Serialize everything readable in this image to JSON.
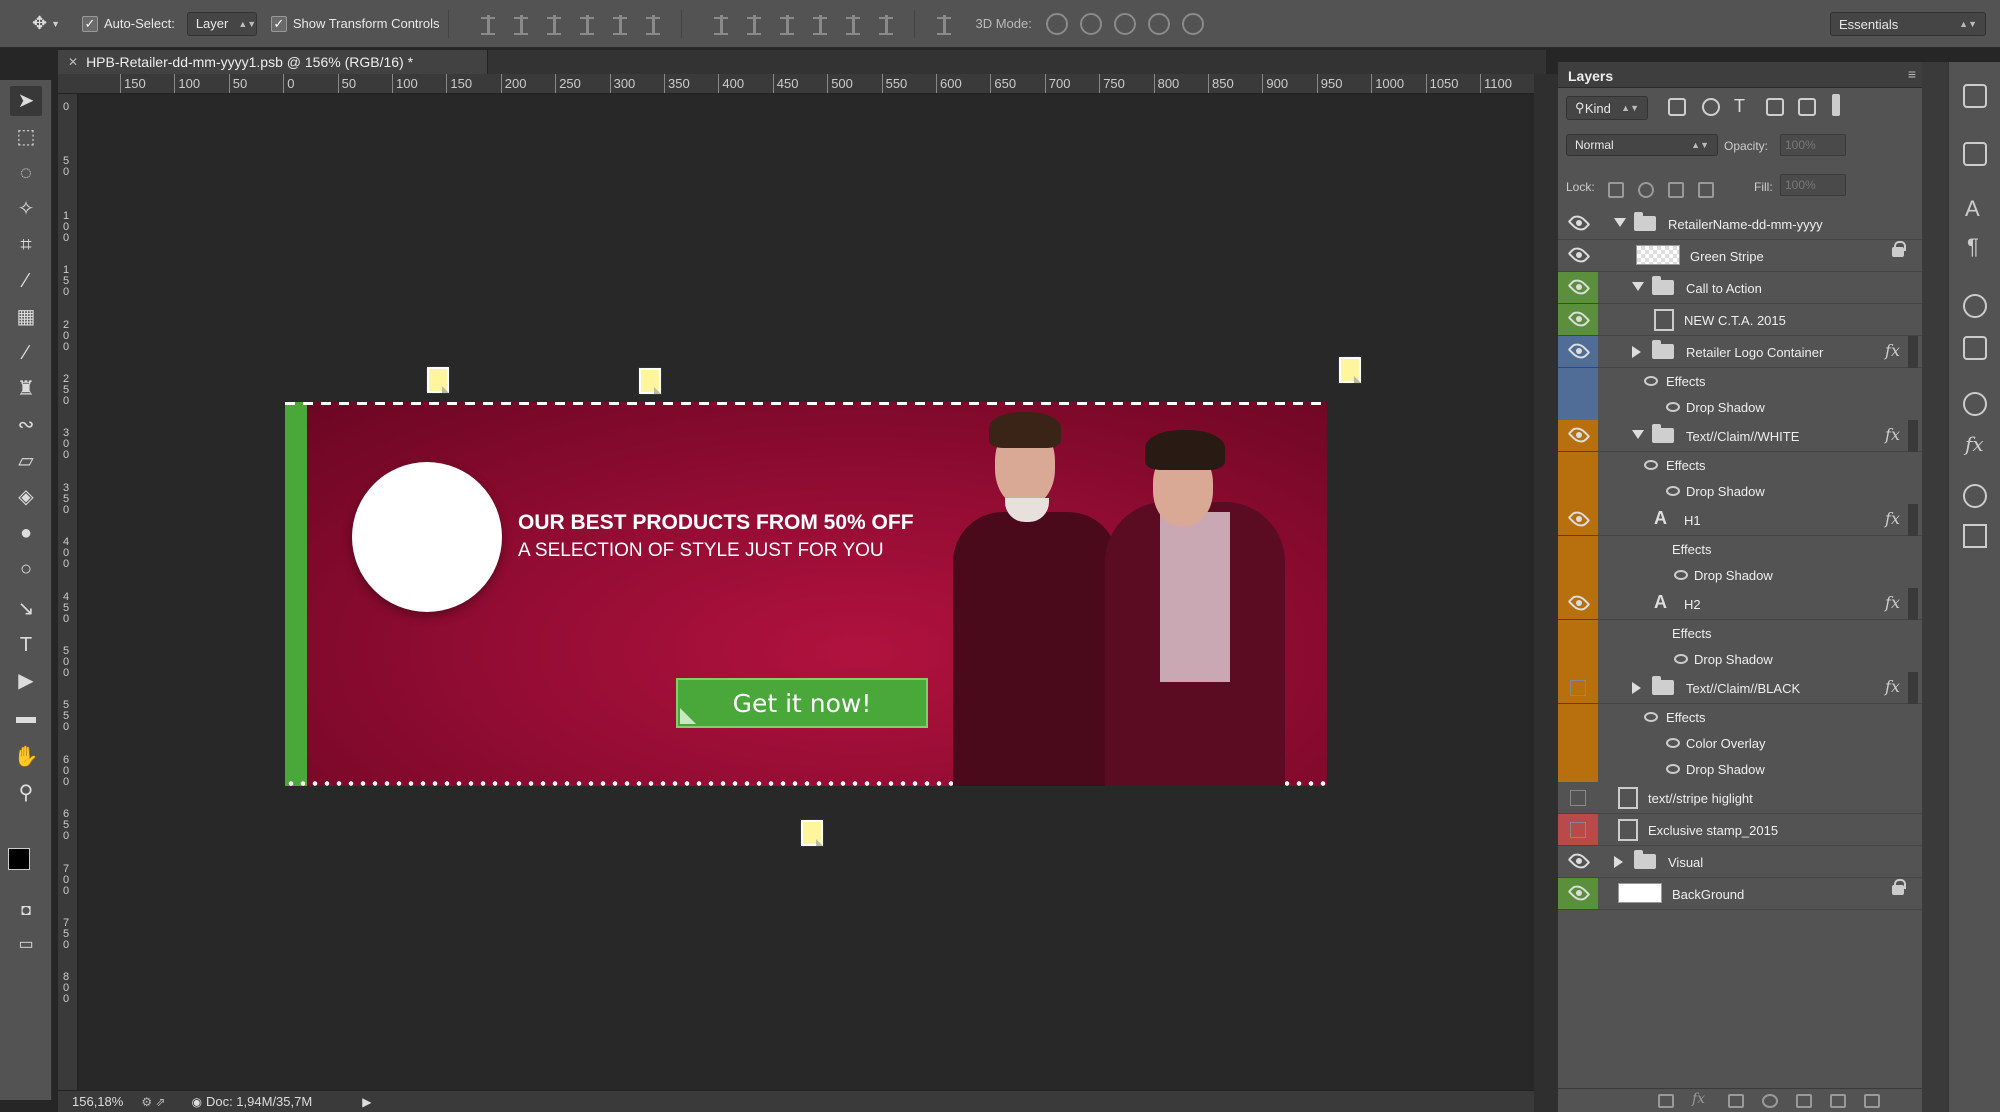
{
  "options_bar": {
    "tool_icon": "move-tool-icon",
    "auto_select_label": "Auto-Select:",
    "auto_select_checked": true,
    "auto_select_target": "Layer",
    "show_transform_label": "Show Transform Controls",
    "show_transform_checked": true,
    "mode_3d_label": "3D Mode:",
    "workspace": "Essentials"
  },
  "document": {
    "tab_title": "HPB-Retailer-dd-mm-yyyy1.psb @ 156% (RGB/16) *"
  },
  "ruler": {
    "top_labels": [
      "150",
      "100",
      "50",
      "0",
      "50",
      "100",
      "150",
      "200",
      "250",
      "300",
      "350",
      "400",
      "450",
      "500",
      "550",
      "600",
      "650",
      "700",
      "750",
      "800",
      "850",
      "900",
      "950",
      "1000",
      "1050",
      "1100"
    ],
    "left_labels": [
      "0",
      "50",
      "100",
      "150",
      "200",
      "250",
      "300",
      "350",
      "400",
      "450",
      "500",
      "550",
      "600",
      "650",
      "700",
      "750",
      "800"
    ]
  },
  "banner": {
    "headline": "OUR BEST PRODUCTS FROM 50% OFF",
    "subline": "A SELECTION OF STYLE JUST FOR YOU",
    "cta_label": "Get it now!",
    "background_color": "#930c33",
    "stripe_color": "#4aa83a"
  },
  "status_bar": {
    "zoom": "156,18%",
    "doc_info": "Doc: 1,94M/35,7M"
  },
  "layers_panel": {
    "title": "Layers",
    "filter_kind": "Kind",
    "blend_mode": "Normal",
    "opacity_label": "Opacity:",
    "opacity_value": "100%",
    "lock_label": "Lock:",
    "fill_label": "Fill:",
    "fill_value": "100%",
    "layers": [
      {
        "name": "RetailerName-dd-mm-yyyy",
        "type": "group",
        "expanded": true,
        "visible": true,
        "color": "none"
      },
      {
        "name": "Green Stripe",
        "type": "pixel",
        "visible": true,
        "locked": true,
        "color": "none"
      },
      {
        "name": "Call to Action",
        "type": "group",
        "expanded": true,
        "visible": true,
        "color": "#5a8f3c"
      },
      {
        "name": "NEW C.T.A. 2015",
        "type": "smart",
        "visible": true,
        "color": "#5a8f3c"
      },
      {
        "name": "Retailer Logo Container",
        "type": "group",
        "expanded": false,
        "visible": true,
        "fx": true,
        "color": "#4f6d96"
      },
      {
        "name": "Effects",
        "type": "effects",
        "color": "#4f6d96"
      },
      {
        "name": "Drop Shadow",
        "type": "effect",
        "color": "#4f6d96"
      },
      {
        "name": "Text//Claim//WHITE",
        "type": "group",
        "expanded": true,
        "visible": true,
        "fx": true,
        "color": "#b8700f"
      },
      {
        "name": "Effects",
        "type": "effects",
        "color": "#b8700f"
      },
      {
        "name": "Drop Shadow",
        "type": "effect",
        "color": "#b8700f"
      },
      {
        "name": "H1",
        "type": "text",
        "visible": true,
        "fx": true,
        "color": "#b8700f"
      },
      {
        "name": "Effects",
        "type": "effects",
        "color": "#b8700f"
      },
      {
        "name": "Drop Shadow",
        "type": "effect",
        "color": "#b8700f"
      },
      {
        "name": "H2",
        "type": "text",
        "visible": true,
        "fx": true,
        "color": "#b8700f"
      },
      {
        "name": "Effects",
        "type": "effects",
        "color": "#b8700f"
      },
      {
        "name": "Drop Shadow",
        "type": "effect",
        "color": "#b8700f"
      },
      {
        "name": "Text//Claim//BLACK",
        "type": "group",
        "expanded": false,
        "visible": false,
        "fx": true,
        "color": "#b8700f"
      },
      {
        "name": "Effects",
        "type": "effects",
        "color": "#b8700f"
      },
      {
        "name": "Color Overlay",
        "type": "effect",
        "color": "#b8700f"
      },
      {
        "name": "Drop Shadow",
        "type": "effect",
        "color": "#b8700f"
      },
      {
        "name": "text//stripe higlight",
        "type": "smart",
        "visible": false,
        "color": "none"
      },
      {
        "name": "Exclusive stamp_2015",
        "type": "smart",
        "visible": false,
        "color": "#b84a4a"
      },
      {
        "name": "Visual",
        "type": "group",
        "expanded": false,
        "visible": true,
        "color": "none"
      },
      {
        "name": "BackGround",
        "type": "pixel",
        "visible": true,
        "locked": true,
        "color": "#5a8f3c"
      }
    ]
  }
}
